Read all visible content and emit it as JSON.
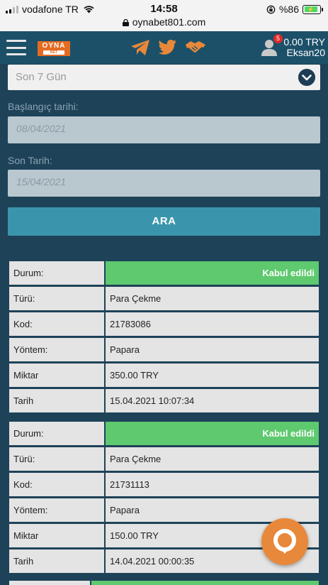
{
  "status_bar": {
    "carrier": "vodafone TR",
    "time": "14:58",
    "url": "oynabet801.com",
    "battery": "%86"
  },
  "header": {
    "logo_top": "OYNA",
    "logo_bottom": "BET",
    "notification_count": "5",
    "balance": "0.00 TRY",
    "username": "Eksan20"
  },
  "filter": {
    "period": "Son 7 Gün",
    "start_label": "Başlangıç tarihi:",
    "start_value": "08/04/2021",
    "end_label": "Son Tarih:",
    "end_value": "15/04/2021",
    "search_button": "ARA"
  },
  "labels": {
    "status": "Durum:",
    "type": "Türü:",
    "code": "Kod:",
    "method": "Yöntem:",
    "amount": "Miktar",
    "date": "Tarih"
  },
  "transactions": [
    {
      "status": "Kabul edildi",
      "type": "Para Çekme",
      "code": "21783086",
      "method": "Papara",
      "amount": "350.00 TRY",
      "date": "15.04.2021 10:07:34"
    },
    {
      "status": "Kabul edildi",
      "type": "Para Çekme",
      "code": "21731113",
      "method": "Papara",
      "amount": "150.00 TRY",
      "date": "14.04.2021 00:00:35"
    }
  ],
  "colors": {
    "background": "#1e4258",
    "header": "#1c5069",
    "accent": "#3a95ac",
    "success": "#5ec96e",
    "brand": "#e46b22"
  }
}
